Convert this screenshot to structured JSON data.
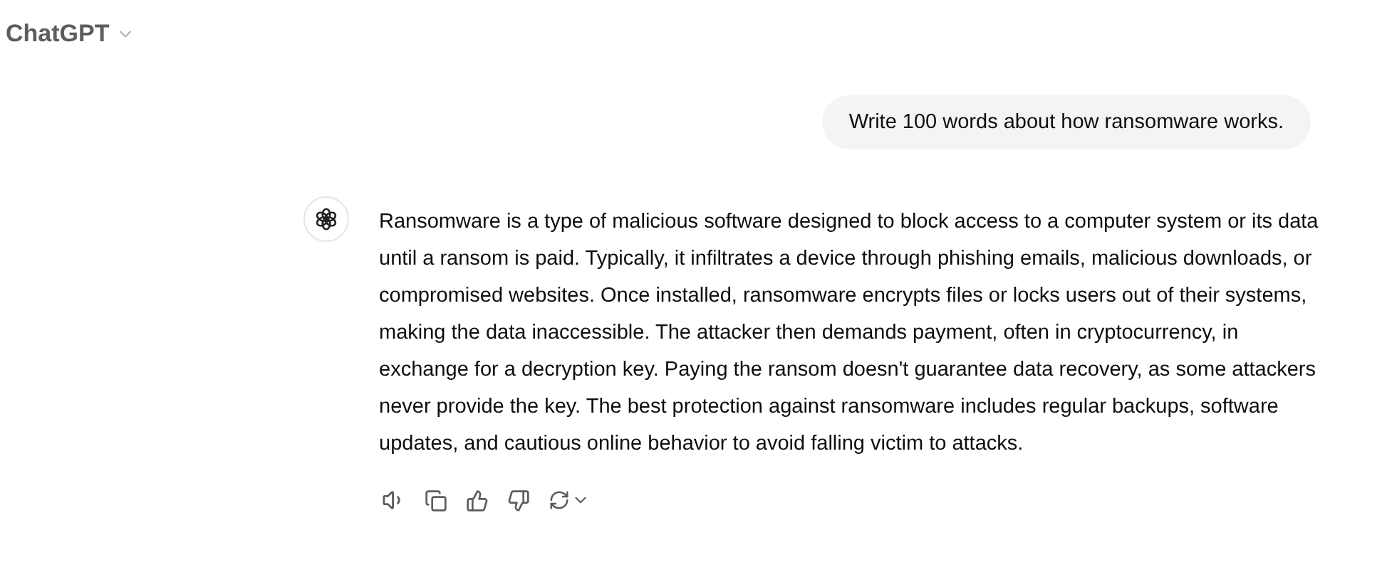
{
  "header": {
    "title": "ChatGPT"
  },
  "messages": [
    {
      "kind": "user",
      "text": "Write 100 words about how ransomware works."
    },
    {
      "kind": "assistant",
      "text": "Ransomware is a type of malicious software designed to block access to a computer system or its data until a ransom is paid. Typically, it infiltrates a device through phishing emails, malicious downloads, or compromised websites. Once installed, ransomware encrypts files or locks users out of their systems, making the data inaccessible. The attacker then demands payment, often in cryptocurrency, in exchange for a decryption key. Paying the ransom doesn't guarantee data recovery, as some attackers never provide the key. The best protection against ransomware includes regular backups, software updates, and cautious online behavior to avoid falling victim to attacks."
    }
  ]
}
